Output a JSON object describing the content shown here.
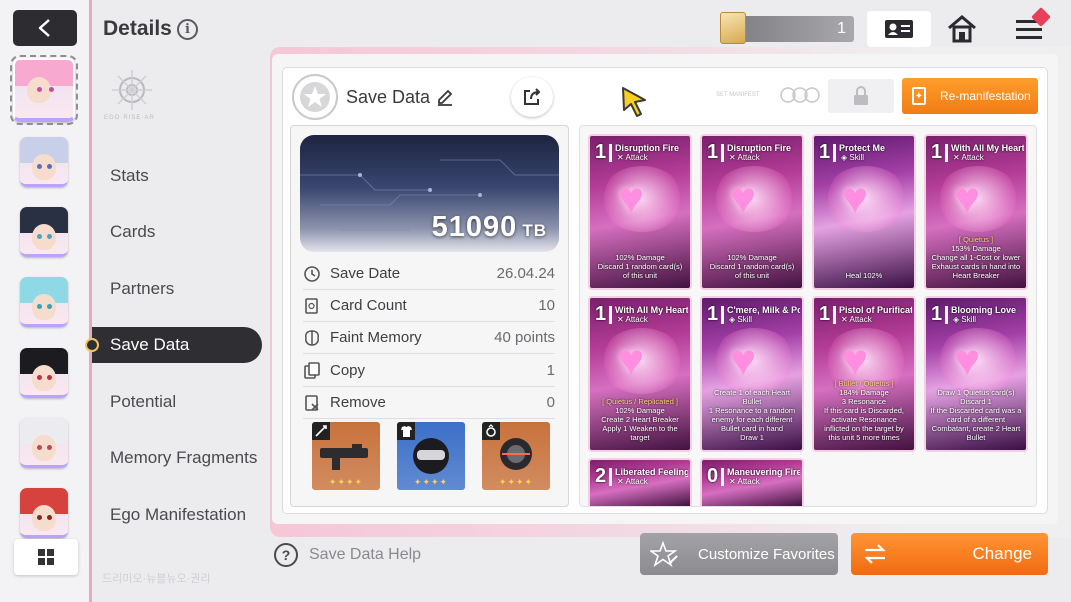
{
  "header": {
    "title": "Details",
    "ticket_count": "1"
  },
  "characters": [
    {
      "name": "char-pink",
      "hair": "#f7a9cf",
      "eyes": "#c44fa0",
      "selected": true
    },
    {
      "name": "char-silver",
      "hair": "#c8cfe8",
      "eyes": "#5a6cc2"
    },
    {
      "name": "char-dark",
      "hair": "#2a3044",
      "eyes": "#4aa3c9"
    },
    {
      "name": "char-teal",
      "hair": "#8fd9e6",
      "eyes": "#2fa6b6"
    },
    {
      "name": "char-black",
      "hair": "#1b1b20",
      "eyes": "#c22e45"
    },
    {
      "name": "char-white",
      "hair": "#ecebef",
      "eyes": "#b5495b"
    },
    {
      "name": "char-red",
      "hair": "#d6423e",
      "eyes": "#7b2a2a"
    }
  ],
  "nav": {
    "crest_text": "EGO·RISE·AR",
    "items": [
      {
        "label": "Stats",
        "active": false
      },
      {
        "label": "Cards",
        "active": false
      },
      {
        "label": "Partners",
        "active": false
      },
      {
        "label": "Save Data",
        "active": true
      },
      {
        "label": "Potential",
        "active": false
      },
      {
        "label": "Memory Fragments",
        "active": false
      },
      {
        "label": "Ego Manifestation",
        "active": false
      }
    ]
  },
  "bottom_watermark": "드리미오·뉴블뉴오·권리",
  "save": {
    "title": "Save Data",
    "tb_value": "51090",
    "tb_unit": "TB",
    "reman_label": "Re-manifestation",
    "small_stamp": "SET MANIFEST",
    "stats": [
      {
        "label": "Save Date",
        "value": "26.04.24",
        "icon": "clock-icon"
      },
      {
        "label": "Card Count",
        "value": "10",
        "icon": "card-icon"
      },
      {
        "label": "Faint Memory",
        "value": "40",
        "value_unit": "points",
        "icon": "brain-icon"
      },
      {
        "label": "Copy",
        "value": "1",
        "icon": "copy-icon"
      },
      {
        "label": "Remove",
        "value": "0",
        "icon": "remove-icon"
      }
    ],
    "equipment": [
      {
        "name": "weapon",
        "color": "#c8723b",
        "icon": "sword-icon",
        "stars": "✦✦✦✦"
      },
      {
        "name": "armor",
        "color": "#3c6fc8",
        "icon": "shirt-icon",
        "stars": "✦✦✦✦"
      },
      {
        "name": "accessory",
        "color": "#c8723b",
        "icon": "ring-icon",
        "stars": "✦✦✦✦"
      }
    ]
  },
  "cards": [
    {
      "cost": "1",
      "name": "Disruption Fire",
      "type": "Attack",
      "kind": "attack",
      "desc": "102% Damage\nDiscard 1 random card(s) of this unit",
      "tag": ""
    },
    {
      "cost": "1",
      "name": "Disruption Fire",
      "type": "Attack",
      "kind": "attack",
      "desc": "102% Damage\nDiscard 1 random card(s) of this unit",
      "tag": ""
    },
    {
      "cost": "1",
      "name": "Protect Me",
      "type": "Skill",
      "kind": "skill",
      "desc": "Heal 102%",
      "tag": ""
    },
    {
      "cost": "1",
      "name": "With All My Heart!",
      "type": "Attack",
      "kind": "attack",
      "desc": "153% Damage\nChange all 1-Cost or lower Exhaust cards in hand into Heart Breaker",
      "tag": "[ Quietus ]"
    },
    {
      "cost": "1",
      "name": "With All My Heart!",
      "type": "Attack",
      "kind": "attack",
      "desc": "102% Damage\nCreate 2 Heart Breaker\nApply 1 Weaken to the target",
      "tag": "[ Quietus / Replicated ]"
    },
    {
      "cost": "1",
      "name": "C'mere, Milk & Pong!",
      "type": "Skill",
      "kind": "skill",
      "desc": "Create 1 of each Heart Bullet\n1 Resonance to a random enemy for each different Bullet card in hand\nDraw 1",
      "tag": ""
    },
    {
      "cost": "1",
      "name": "Pistol of Purification",
      "type": "Attack",
      "kind": "attack",
      "desc": "184% Damage\n3 Resonance\nIf this card is Discarded, activate Resonance inflicted on the target by this unit 5 more times",
      "tag": "[ Bullet / Quietus ]"
    },
    {
      "cost": "1",
      "name": "Blooming Love",
      "type": "Skill",
      "kind": "skill",
      "desc": "Draw 1 Quietus card(s)\nDiscard 1\nIf the Discarded card was a card of a different Combatant, create 2 Heart Bullet",
      "tag": ""
    },
    {
      "cost": "2",
      "name": "Liberated Feelings",
      "type": "Attack",
      "kind": "attack",
      "desc": "",
      "tag": ""
    },
    {
      "cost": "0",
      "name": "Maneuvering Fire",
      "type": "Attack",
      "kind": "attack",
      "desc": "",
      "tag": ""
    }
  ],
  "bottom": {
    "help_label": "Save Data Help",
    "favorites_label": "Customize Favorites",
    "change_label": "Change"
  },
  "colors": {
    "accent_orange": "#f07d16",
    "nav_active": "#2f2f33",
    "rail_border": "#e9a7c0"
  }
}
